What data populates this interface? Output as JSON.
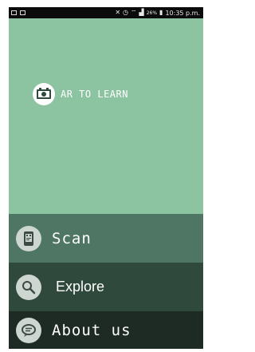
{
  "status_bar": {
    "battery": "26%",
    "time": "10:35 p.m."
  },
  "brand": {
    "title": "AR TO LEARN",
    "logo_icon": "film-reel-icon"
  },
  "menu": {
    "items": [
      {
        "label": "Scan",
        "icon": "phone-scan-icon"
      },
      {
        "label": "Explore",
        "icon": "search-icon"
      },
      {
        "label": "About us",
        "icon": "chat-bubble-icon"
      }
    ]
  },
  "colors": {
    "hero": "#8cc3a1",
    "scan": "#4f7664",
    "explore": "#2f4a3d",
    "about": "#1e2a24"
  }
}
